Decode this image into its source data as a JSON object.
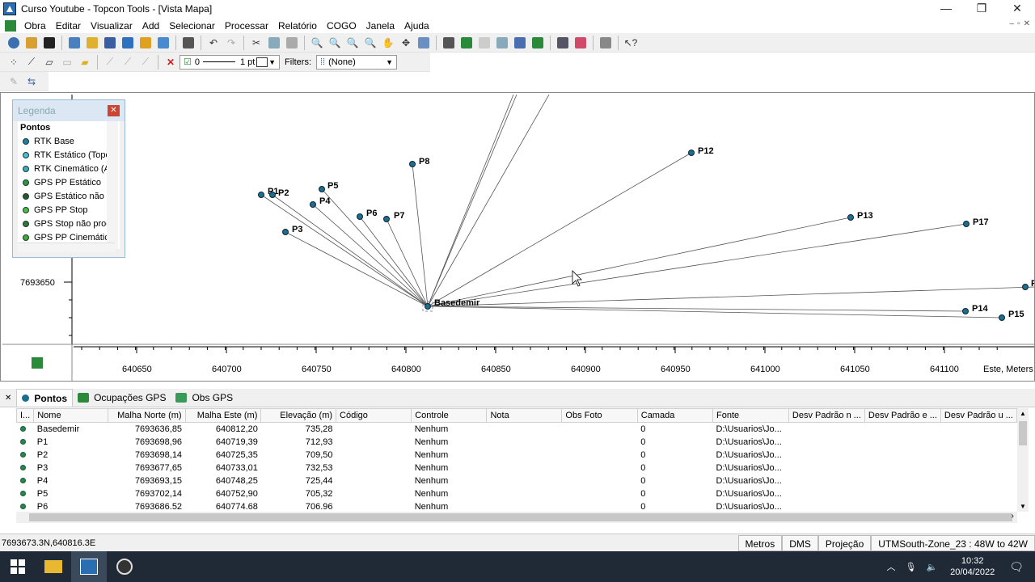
{
  "window": {
    "title": "Curso Youtube - Topcon Tools - [Vista Mapa]"
  },
  "menu": [
    "Obra",
    "Editar",
    "Visualizar",
    "Add",
    "Selecionar",
    "Processar",
    "Relatório",
    "COGO",
    "Janela",
    "Ajuda"
  ],
  "toolbar2": {
    "line_width_value": "0",
    "pt_label": "1 pt",
    "filters_label": "Filters:",
    "filter_value": "(None)"
  },
  "legend": {
    "title": "Legenda",
    "section": "Pontos",
    "items": [
      {
        "label": "RTK Base",
        "color": "#1a7fa0"
      },
      {
        "label": "RTK Estático (Topo",
        "color": "#46c0d0"
      },
      {
        "label": "RTK Cinemático (A",
        "color": "#3aaec0"
      },
      {
        "label": "GPS PP Estático",
        "color": "#2a9a3a"
      },
      {
        "label": "GPS Estático não p",
        "color": "#235c2a"
      },
      {
        "label": "GPS PP Stop",
        "color": "#4ac040"
      },
      {
        "label": "GPS Stop não proc",
        "color": "#2a7a3a"
      },
      {
        "label": "GPS PP Cinemático",
        "color": "#3ab030"
      }
    ]
  },
  "map": {
    "y_tick_label": "7693650",
    "x_ticks": [
      "640650",
      "640700",
      "640750",
      "640800",
      "640850",
      "640900",
      "640950",
      "641000",
      "641050",
      "641100"
    ],
    "x_axis_label": "Este, Meters",
    "base_label": "Basedemir",
    "points": [
      "P1",
      "P2",
      "P3",
      "P4",
      "P5",
      "P6",
      "P7",
      "P8",
      "P12",
      "P13",
      "P17",
      "P14",
      "P15"
    ],
    "cut_label": "P"
  },
  "tabs": [
    "Pontos",
    "Ocupações GPS",
    "Obs GPS"
  ],
  "table": {
    "columns": [
      "I...",
      "Nome",
      "Malha Norte (m)",
      "Malha Este (m)",
      "Elevação (m)",
      "Código",
      "Controle",
      "Nota",
      "Obs Foto",
      "Camada",
      "Fonte",
      "Desv Padrão n ...",
      "Desv Padrão e ...",
      "Desv Padrão u ..."
    ],
    "rows": [
      [
        "Basedemir",
        "7693636,85",
        "640812,20",
        "735,28",
        "",
        "Nenhum",
        "",
        "",
        "0",
        "D:\\Usuarios\\Jo..."
      ],
      [
        "P1",
        "7693698,96",
        "640719,39",
        "712,93",
        "",
        "Nenhum",
        "",
        "",
        "0",
        "D:\\Usuarios\\Jo..."
      ],
      [
        "P2",
        "7693698,14",
        "640725,35",
        "709,50",
        "",
        "Nenhum",
        "",
        "",
        "0",
        "D:\\Usuarios\\Jo..."
      ],
      [
        "P3",
        "7693677,65",
        "640733,01",
        "732,53",
        "",
        "Nenhum",
        "",
        "",
        "0",
        "D:\\Usuarios\\Jo..."
      ],
      [
        "P4",
        "7693693,15",
        "640748,25",
        "725,44",
        "",
        "Nenhum",
        "",
        "",
        "0",
        "D:\\Usuarios\\Jo..."
      ],
      [
        "P5",
        "7693702,14",
        "640752,90",
        "705,32",
        "",
        "Nenhum",
        "",
        "",
        "0",
        "D:\\Usuarios\\Jo..."
      ],
      [
        "P6",
        "7693686.52",
        "640774.68",
        "706.96",
        "",
        "Nenhum",
        "",
        "",
        "0",
        "D:\\Usuarios\\Jo..."
      ]
    ]
  },
  "status": {
    "coords": "7693673.3N,640816.3E",
    "units": "Metros",
    "angle": "DMS",
    "projection": "Projeção",
    "zone": "UTMSouth-Zone_23 : 48W to 42W"
  },
  "taskbar": {
    "time": "10:32",
    "date": "20/04/2022"
  }
}
